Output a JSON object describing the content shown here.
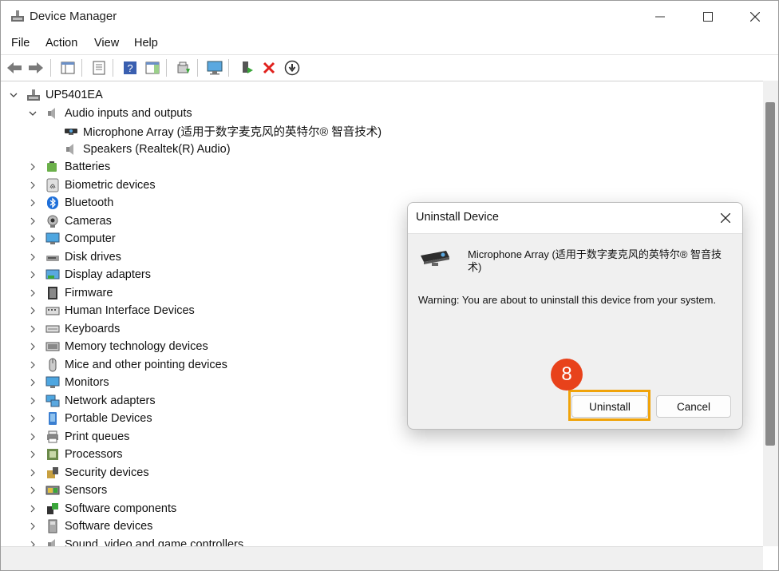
{
  "window": {
    "title": "Device Manager"
  },
  "menu": [
    "File",
    "Action",
    "View",
    "Help"
  ],
  "toolbar": {
    "icons": [
      "back-arrow-icon",
      "forward-arrow-icon",
      "properties-pane-icon",
      "device-properties-icon",
      "help-icon",
      "action-pane-icon",
      "update-driver-icon",
      "monitor-scan-icon",
      "enable-device-icon",
      "uninstall-device-icon",
      "disable-device-icon"
    ]
  },
  "tree": {
    "root": "UP5401EA",
    "expanded_category": "Audio inputs and outputs",
    "audio_children": [
      {
        "label": "Microphone Array (适用于数字麦克风的英特尔® 智音技术)",
        "icon": "webcam-icon"
      },
      {
        "label": "Speakers (Realtek(R) Audio)",
        "icon": "speaker-icon"
      }
    ],
    "categories": [
      {
        "label": "Batteries",
        "icon": "battery-icon"
      },
      {
        "label": "Biometric devices",
        "icon": "fingerprint-icon"
      },
      {
        "label": "Bluetooth",
        "icon": "bluetooth-icon"
      },
      {
        "label": "Cameras",
        "icon": "camera-icon"
      },
      {
        "label": "Computer",
        "icon": "computer-icon"
      },
      {
        "label": "Disk drives",
        "icon": "disk-drive-icon"
      },
      {
        "label": "Display adapters",
        "icon": "display-adapter-icon"
      },
      {
        "label": "Firmware",
        "icon": "firmware-icon"
      },
      {
        "label": "Human Interface Devices",
        "icon": "hid-icon"
      },
      {
        "label": "Keyboards",
        "icon": "keyboard-icon"
      },
      {
        "label": "Memory technology devices",
        "icon": "memory-icon"
      },
      {
        "label": "Mice and other pointing devices",
        "icon": "mouse-icon"
      },
      {
        "label": "Monitors",
        "icon": "monitor-icon"
      },
      {
        "label": "Network adapters",
        "icon": "network-adapter-icon"
      },
      {
        "label": "Portable Devices",
        "icon": "portable-device-icon"
      },
      {
        "label": "Print queues",
        "icon": "printer-icon"
      },
      {
        "label": "Processors",
        "icon": "processor-icon"
      },
      {
        "label": "Security devices",
        "icon": "security-device-icon"
      },
      {
        "label": "Sensors",
        "icon": "sensor-icon"
      },
      {
        "label": "Software components",
        "icon": "software-component-icon"
      },
      {
        "label": "Software devices",
        "icon": "software-device-icon"
      },
      {
        "label": "Sound, video and game controllers",
        "icon": "sound-icon"
      }
    ]
  },
  "dialog": {
    "title": "Uninstall Device",
    "device_name": "Microphone Array (适用于数字麦克风的英特尔® 智音技术)",
    "warning": "Warning: You are about to uninstall this device from your system.",
    "uninstall_label": "Uninstall",
    "cancel_label": "Cancel"
  },
  "annotation": {
    "step": "8",
    "color": "#e8421b",
    "highlight_color": "#f0a30a"
  }
}
